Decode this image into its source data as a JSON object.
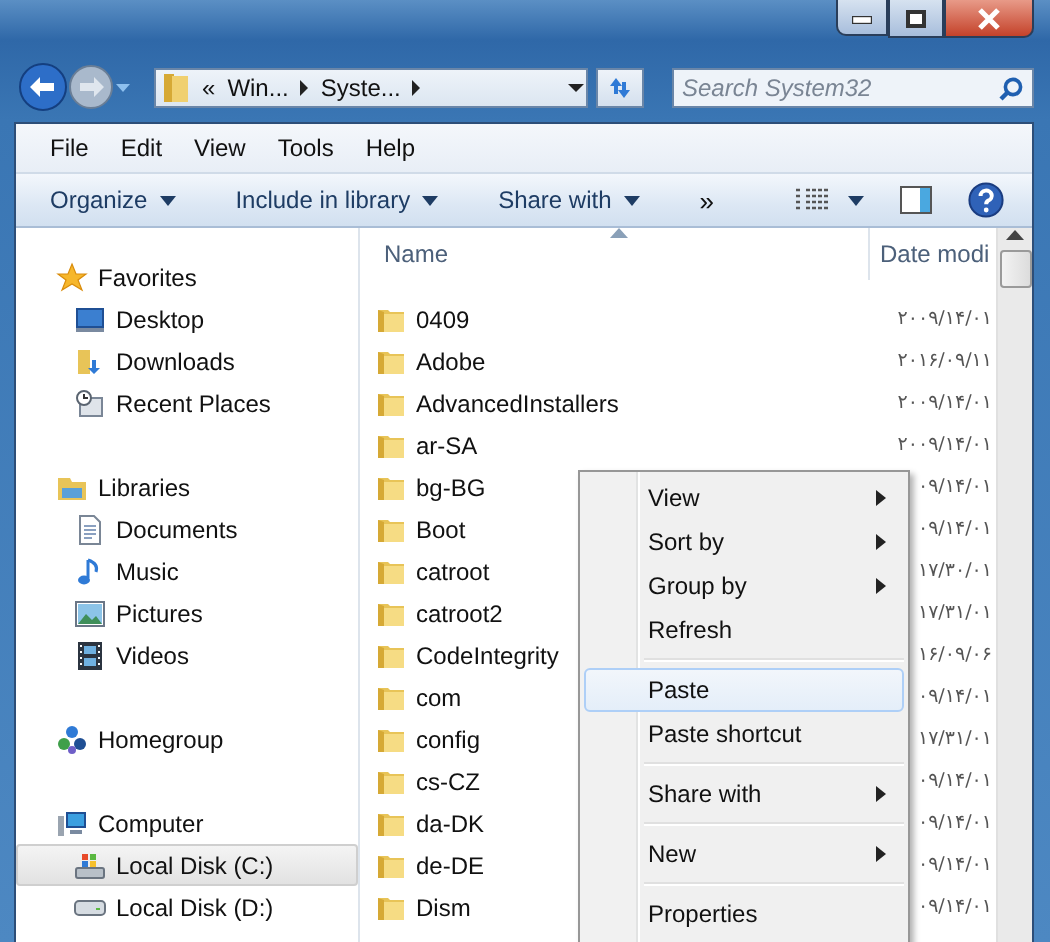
{
  "address": {
    "crumbs": [
      "«",
      "Win...",
      "Syste..."
    ]
  },
  "search": {
    "placeholder": "Search System32"
  },
  "menu_bar": [
    "File",
    "Edit",
    "View",
    "Tools",
    "Help"
  ],
  "toolbar": [
    {
      "label": "Organize",
      "kind": "dropdown"
    },
    {
      "label": "Include in library",
      "kind": "dropdown"
    },
    {
      "label": "Share with",
      "kind": "dropdown"
    },
    {
      "label": "»",
      "kind": "overflow"
    }
  ],
  "nav": [
    {
      "label": "Favorites",
      "kind": "star",
      "children": [
        {
          "label": "Desktop",
          "kind": "desktop",
          "selected": false
        },
        {
          "label": "Downloads",
          "kind": "downloads",
          "selected": false
        },
        {
          "label": "Recent Places",
          "kind": "recent",
          "selected": false
        }
      ]
    },
    {
      "label": "Libraries",
      "kind": "library",
      "children": [
        {
          "label": "Documents",
          "kind": "document",
          "selected": false
        },
        {
          "label": "Music",
          "kind": "music",
          "selected": false
        },
        {
          "label": "Pictures",
          "kind": "pictures",
          "selected": false
        },
        {
          "label": "Videos",
          "kind": "videos",
          "selected": false
        }
      ]
    },
    {
      "label": "Homegroup",
      "kind": "homegroup"
    },
    {
      "label": "Computer",
      "kind": "computer",
      "children": [
        {
          "label": "Local Disk (C:)",
          "kind": "system-disk",
          "selected": true
        },
        {
          "label": "Local Disk (D:)",
          "kind": "disk",
          "selected": false
        }
      ]
    }
  ],
  "file_list": {
    "columns": [
      "Name",
      "Date modi"
    ],
    "rows": [
      {
        "name": "0409",
        "date": "۲۰۰۹/۱۴/۰۱"
      },
      {
        "name": "Adobe",
        "date": "۲۰۱۶/۰۹/۱۱"
      },
      {
        "name": "AdvancedInstallers",
        "date": "۲۰۰۹/۱۴/۰۱"
      },
      {
        "name": "ar-SA",
        "date": "۲۰۰۹/۱۴/۰۱"
      },
      {
        "name": "bg-BG",
        "date": "۰۹/۱۴/۰۱"
      },
      {
        "name": "Boot",
        "date": "۰۹/۱۴/۰۱"
      },
      {
        "name": "catroot",
        "date": "۱۷/۳۰/۰۱"
      },
      {
        "name": "catroot2",
        "date": "۱۷/۳۱/۰۱"
      },
      {
        "name": "CodeIntegrity",
        "date": "۱۶/۰۹/۰۶"
      },
      {
        "name": "com",
        "date": "۰۹/۱۴/۰۱"
      },
      {
        "name": "config",
        "date": "۱۷/۳۱/۰۱"
      },
      {
        "name": "cs-CZ",
        "date": "۰۹/۱۴/۰۱"
      },
      {
        "name": "da-DK",
        "date": "۰۹/۱۴/۰۱"
      },
      {
        "name": "de-DE",
        "date": "۰۹/۱۴/۰۱"
      },
      {
        "name": "Dism",
        "date": "۰۹/۱۴/۰۱"
      }
    ]
  },
  "context_menu": [
    {
      "kind": "item",
      "label": "View",
      "submenu": true,
      "selected": false
    },
    {
      "kind": "item",
      "label": "Sort by",
      "submenu": true,
      "selected": false
    },
    {
      "kind": "item",
      "label": "Group by",
      "submenu": true,
      "selected": false
    },
    {
      "kind": "item",
      "label": "Refresh",
      "submenu": false,
      "selected": false
    },
    {
      "kind": "separator"
    },
    {
      "kind": "item",
      "label": "Paste",
      "submenu": false,
      "selected": true
    },
    {
      "kind": "item",
      "label": "Paste shortcut",
      "submenu": false,
      "selected": false
    },
    {
      "kind": "separator"
    },
    {
      "kind": "item",
      "label": "Share with",
      "submenu": true,
      "selected": false
    },
    {
      "kind": "separator"
    },
    {
      "kind": "item",
      "label": "New",
      "submenu": true,
      "selected": false
    },
    {
      "kind": "separator"
    },
    {
      "kind": "item",
      "label": "Properties",
      "submenu": false,
      "selected": false
    }
  ]
}
